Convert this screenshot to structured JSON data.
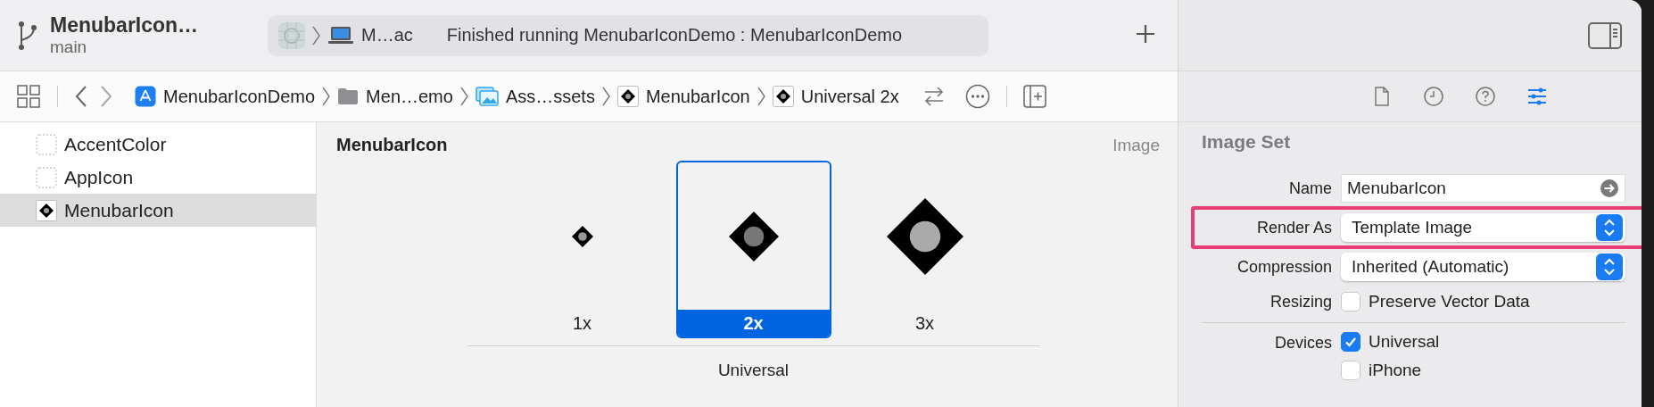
{
  "toolbar": {
    "project_title": "MenubarIcon…",
    "branch": "main",
    "scheme_device": "M…ac",
    "status": "Finished running MenubarIconDemo : MenubarIconDemo"
  },
  "jump_bar": [
    {
      "label": "MenubarIconDemo",
      "kind": "app"
    },
    {
      "label": "Men…emo",
      "kind": "folder"
    },
    {
      "label": "Ass…ssets",
      "kind": "assets"
    },
    {
      "label": "MenubarIcon",
      "kind": "imageset"
    },
    {
      "label": "Universal 2x",
      "kind": "imageset"
    }
  ],
  "inspector_tabs": [
    {
      "kind": "file",
      "selected": false
    },
    {
      "kind": "history",
      "selected": false
    },
    {
      "kind": "help",
      "selected": false
    },
    {
      "kind": "attributes",
      "selected": true
    }
  ],
  "navigator": {
    "items": [
      {
        "label": "AccentColor",
        "kind": "color",
        "selected": false
      },
      {
        "label": "AppIcon",
        "kind": "appicon",
        "selected": false
      },
      {
        "label": "MenubarIcon",
        "kind": "imageset",
        "selected": true
      }
    ]
  },
  "editor": {
    "title": "MenubarIcon",
    "type_label": "Image",
    "group_label": "Universal",
    "slots": [
      {
        "label": "1x",
        "kind": "small",
        "selected": false
      },
      {
        "label": "2x",
        "kind": "medium",
        "selected": true
      },
      {
        "label": "3x",
        "kind": "large",
        "selected": false
      }
    ]
  },
  "inspector": {
    "title": "Image Set",
    "fields": [
      {
        "label": "Name",
        "kind": "text",
        "value": "MenubarIcon"
      },
      {
        "label": "Render As",
        "kind": "popup",
        "value": "Template Image",
        "highlighted": true
      },
      {
        "label": "Compression",
        "kind": "popup",
        "value": "Inherited (Automatic)",
        "highlighted": false
      },
      {
        "label": "Resizing",
        "kind": "checkbox",
        "options": [
          {
            "label": "Preserve Vector Data",
            "checked": false
          }
        ]
      },
      {
        "label": "Devices",
        "kind": "checklist",
        "options": [
          {
            "label": "Universal",
            "checked": true
          },
          {
            "label": "iPhone",
            "checked": false
          }
        ]
      }
    ]
  }
}
